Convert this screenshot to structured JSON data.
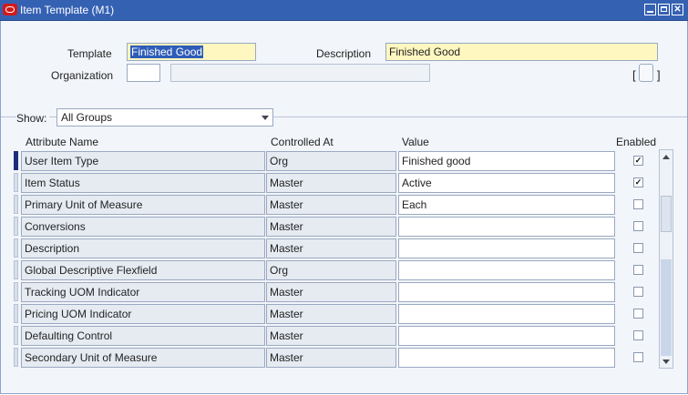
{
  "window": {
    "title": "Item Template (M1)"
  },
  "header": {
    "template_label": "Template",
    "template_value": "Finished Good",
    "description_label": "Description",
    "description_value": "Finished Good",
    "organization_label": "Organization",
    "organization_value": "",
    "organization_name_value": "",
    "flex_open": "[",
    "flex_close": "]"
  },
  "filter": {
    "show_label": "Show:",
    "show_value": "All Groups"
  },
  "table": {
    "headers": {
      "attribute": "Attribute Name",
      "controlled": "Controlled At",
      "value": "Value",
      "enabled": "Enabled"
    },
    "rows": [
      {
        "attribute": "User Item Type",
        "controlled": "Org",
        "value": "Finished good",
        "enabled": true
      },
      {
        "attribute": "Item Status",
        "controlled": "Master",
        "value": "Active",
        "enabled": true
      },
      {
        "attribute": "Primary Unit of Measure",
        "controlled": "Master",
        "value": "Each",
        "enabled": false
      },
      {
        "attribute": "Conversions",
        "controlled": "Master",
        "value": "",
        "enabled": false
      },
      {
        "attribute": "Description",
        "controlled": "Master",
        "value": "",
        "enabled": false
      },
      {
        "attribute": "Global Descriptive Flexfield",
        "controlled": "Org",
        "value": "",
        "enabled": false
      },
      {
        "attribute": "Tracking UOM Indicator",
        "controlled": "Master",
        "value": "",
        "enabled": false
      },
      {
        "attribute": "Pricing UOM Indicator",
        "controlled": "Master",
        "value": "",
        "enabled": false
      },
      {
        "attribute": "Defaulting Control",
        "controlled": "Master",
        "value": "",
        "enabled": false
      },
      {
        "attribute": "Secondary Unit of Measure",
        "controlled": "Master",
        "value": "",
        "enabled": false
      }
    ]
  },
  "colors": {
    "titlebar": "#3561b3",
    "selection": "#2e5cb8",
    "required_field": "#fff7c0"
  },
  "icons": {
    "app": "oracle-icon",
    "minimize": "minimize-icon",
    "maximize": "maximize-icon",
    "close": "close-icon"
  }
}
